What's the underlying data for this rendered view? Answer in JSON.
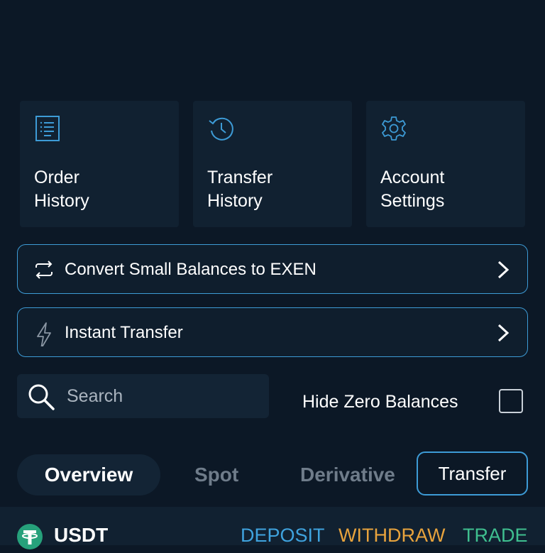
{
  "cards": [
    {
      "label": "Order\nHistory",
      "icon": "document-list-icon"
    },
    {
      "label": "Transfer\nHistory",
      "icon": "history-clock-icon"
    },
    {
      "label": "Account\nSettings",
      "icon": "gear-icon"
    }
  ],
  "actions": {
    "convert_label": "Convert Small Balances to EXEN",
    "instant_transfer_label": "Instant Transfer"
  },
  "search": {
    "placeholder": "Search",
    "value": ""
  },
  "hide_zero": {
    "label": "Hide Zero Balances",
    "checked": false
  },
  "tabs": [
    {
      "label": "Overview",
      "selected": true
    },
    {
      "label": "Spot",
      "selected": false
    },
    {
      "label": "Derivative",
      "selected": false
    }
  ],
  "transfer_button": "Transfer",
  "asset": {
    "symbol": "USDT",
    "deposit": "DEPOSIT",
    "withdraw": "WITHDRAW",
    "trade": "TRADE"
  },
  "colors": {
    "background": "#0c1826",
    "card": "#112131",
    "accent_blue": "#3d9bd6",
    "deposit": "#3fa3de",
    "withdraw": "#e8a33d",
    "trade": "#3fbf8f",
    "tether": "#26a17b"
  }
}
